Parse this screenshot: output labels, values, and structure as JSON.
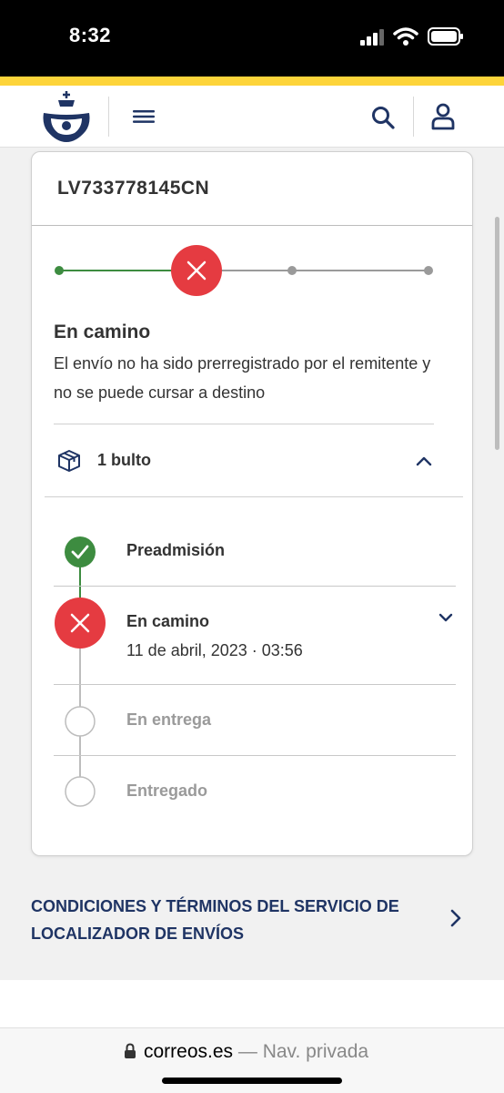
{
  "status_bar": {
    "time": "8:32"
  },
  "colors": {
    "brand_yellow": "#fdd43a",
    "brand_blue": "#1f3464",
    "success": "#3d8c40",
    "error": "#e53b41",
    "inactive": "#9a9a9a"
  },
  "header": {
    "logo": "correos-logo",
    "menu_icon": "hamburger-icon",
    "search_icon": "search-icon",
    "user_icon": "user-icon"
  },
  "card": {
    "tracking_code": "LV733778145CN",
    "status_title": "En camino",
    "status_description": "El envío no ha sido prerregistrado por el remitente y no se puede cursar a destino",
    "package_label": "1 bulto",
    "steps": [
      {
        "label": "Preadmisión",
        "state": "done",
        "date": ""
      },
      {
        "label": "En camino",
        "state": "error",
        "date": "11 de abril, 2023 · 03:56"
      },
      {
        "label": "En entrega",
        "state": "pending",
        "date": ""
      },
      {
        "label": "Entregado",
        "state": "pending",
        "date": ""
      }
    ]
  },
  "terms": {
    "link_text": "CONDICIONES Y TÉRMINOS DEL SERVICIO DE LOCALIZADOR DE ENVÍOS"
  },
  "browser": {
    "domain": "correos.es",
    "mode": " — Nav. privada"
  }
}
